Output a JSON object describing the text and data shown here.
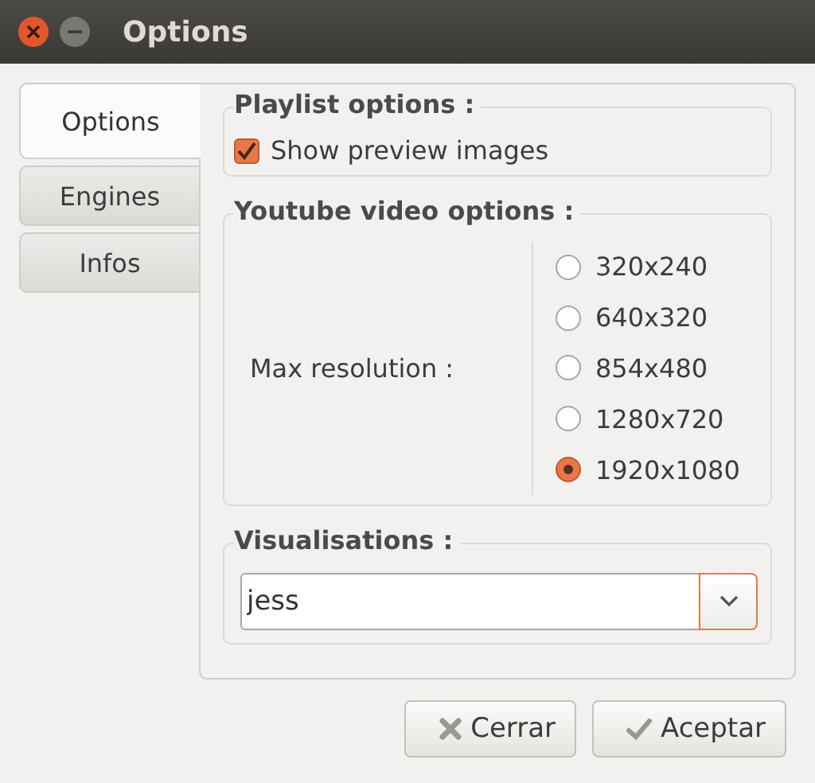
{
  "window": {
    "title": "Options"
  },
  "tabs": [
    {
      "label": "Options",
      "selected": true
    },
    {
      "label": "Engines",
      "selected": false
    },
    {
      "label": "Infos",
      "selected": false
    }
  ],
  "playlist_options": {
    "title": "Playlist options :",
    "checkboxes": [
      {
        "label": "Show preview images",
        "checked": true
      }
    ]
  },
  "youtube_video_options": {
    "title": "Youtube video options :",
    "label": "Max resolution :",
    "resolutions": [
      {
        "label": "320x240",
        "selected": false
      },
      {
        "label": "640x320",
        "selected": false
      },
      {
        "label": "854x480",
        "selected": false
      },
      {
        "label": "1280x720",
        "selected": false
      },
      {
        "label": "1920x1080",
        "selected": true
      }
    ]
  },
  "visualisations": {
    "title": "Visualisations :",
    "value": "jess"
  },
  "buttons": [
    {
      "kind": "close",
      "label": "Cerrar"
    },
    {
      "kind": "accept",
      "label": "Aceptar"
    }
  ]
}
